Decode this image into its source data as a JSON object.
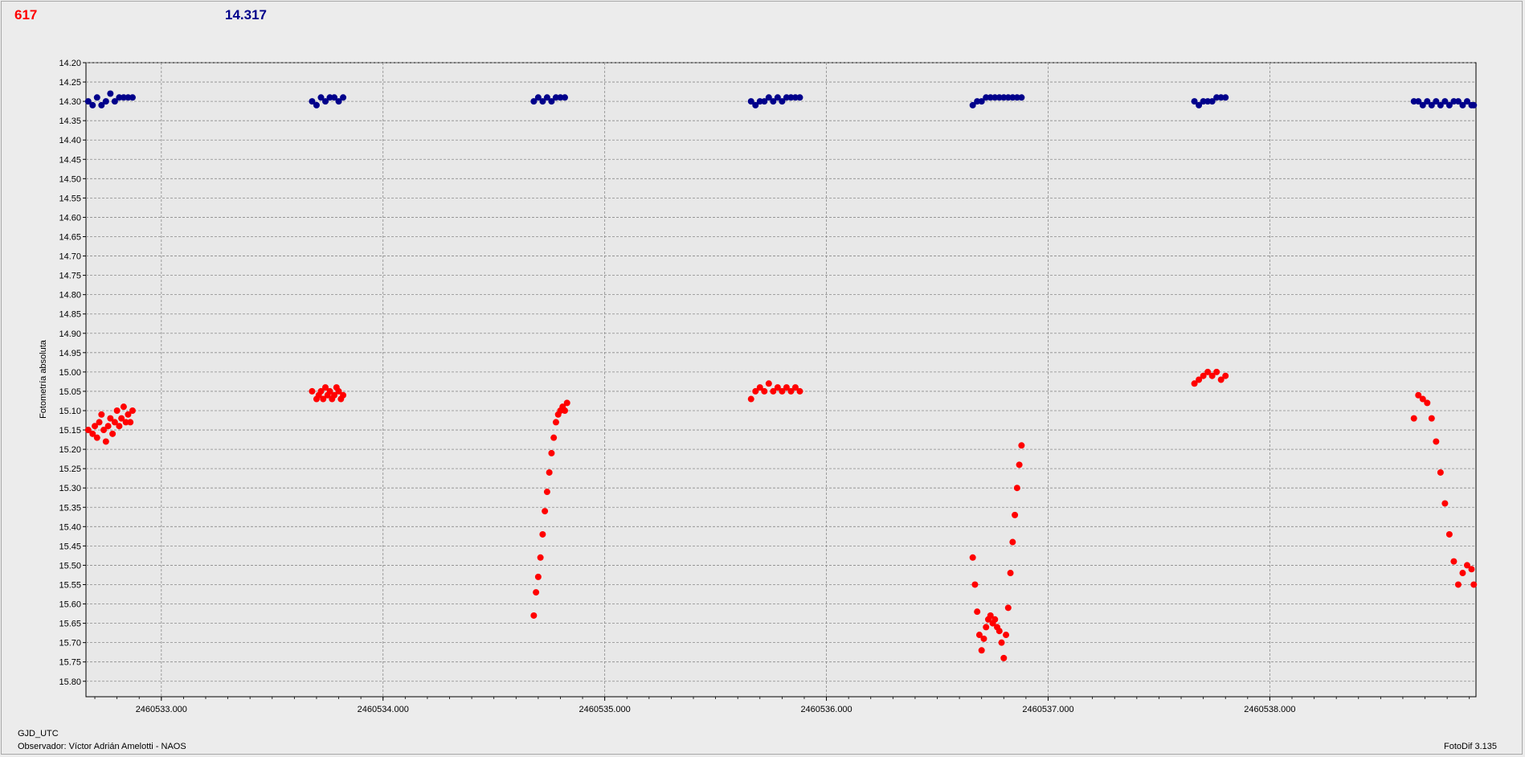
{
  "header": {
    "left_value": "617",
    "right_value": "14.317"
  },
  "footer": {
    "axis_name": "GJD_UTC",
    "observer": "Observador: Víctor Adrián Amelotti - NAOS",
    "software": "FotoDif 3.135"
  },
  "colors": {
    "series_red": "#ff0000",
    "series_blue": "#00008b",
    "grid": "#8a8a8a"
  },
  "chart_data": {
    "type": "scatter",
    "ylabel": "Fotometría absoluta",
    "xlabel": "",
    "y_inverted": true,
    "xlim": [
      2460532.66,
      2460538.93
    ],
    "ylim": [
      14.2,
      15.84
    ],
    "x_ticks": [
      "2460533.000",
      "2460534.000",
      "2460535.000",
      "2460536.000",
      "2460537.000",
      "2460538.000"
    ],
    "y_ticks": [
      "14.20",
      "14.25",
      "14.30",
      "14.35",
      "14.40",
      "14.45",
      "14.50",
      "14.55",
      "14.60",
      "14.65",
      "14.70",
      "14.75",
      "14.80",
      "14.85",
      "14.90",
      "14.95",
      "15.00",
      "15.05",
      "15.10",
      "15.15",
      "15.20",
      "15.25",
      "15.30",
      "15.35",
      "15.40",
      "15.45",
      "15.50",
      "15.55",
      "15.60",
      "15.65",
      "15.70",
      "15.75",
      "15.80"
    ],
    "grid": true,
    "series": [
      {
        "color": "#ff0000",
        "points": [
          [
            2460532.67,
            15.15
          ],
          [
            2460532.69,
            15.16
          ],
          [
            2460532.7,
            15.14
          ],
          [
            2460532.71,
            15.17
          ],
          [
            2460532.72,
            15.13
          ],
          [
            2460532.73,
            15.11
          ],
          [
            2460532.74,
            15.15
          ],
          [
            2460532.75,
            15.18
          ],
          [
            2460532.76,
            15.14
          ],
          [
            2460532.77,
            15.12
          ],
          [
            2460532.78,
            15.16
          ],
          [
            2460532.79,
            15.13
          ],
          [
            2460532.8,
            15.1
          ],
          [
            2460532.81,
            15.14
          ],
          [
            2460532.82,
            15.12
          ],
          [
            2460532.83,
            15.09
          ],
          [
            2460532.84,
            15.13
          ],
          [
            2460532.85,
            15.11
          ],
          [
            2460532.86,
            15.13
          ],
          [
            2460532.87,
            15.1
          ],
          [
            2460533.68,
            15.05
          ],
          [
            2460533.7,
            15.07
          ],
          [
            2460533.71,
            15.06
          ],
          [
            2460533.72,
            15.05
          ],
          [
            2460533.73,
            15.07
          ],
          [
            2460533.74,
            15.04
          ],
          [
            2460533.75,
            15.06
          ],
          [
            2460533.76,
            15.05
          ],
          [
            2460533.77,
            15.07
          ],
          [
            2460533.78,
            15.06
          ],
          [
            2460533.79,
            15.04
          ],
          [
            2460533.8,
            15.05
          ],
          [
            2460533.81,
            15.07
          ],
          [
            2460533.82,
            15.06
          ],
          [
            2460534.68,
            15.63
          ],
          [
            2460534.69,
            15.57
          ],
          [
            2460534.7,
            15.53
          ],
          [
            2460534.71,
            15.48
          ],
          [
            2460534.72,
            15.42
          ],
          [
            2460534.73,
            15.36
          ],
          [
            2460534.74,
            15.31
          ],
          [
            2460534.75,
            15.26
          ],
          [
            2460534.76,
            15.21
          ],
          [
            2460534.77,
            15.17
          ],
          [
            2460534.78,
            15.13
          ],
          [
            2460534.79,
            15.11
          ],
          [
            2460534.8,
            15.1
          ],
          [
            2460534.81,
            15.09
          ],
          [
            2460534.82,
            15.1
          ],
          [
            2460534.83,
            15.08
          ],
          [
            2460535.66,
            15.07
          ],
          [
            2460535.68,
            15.05
          ],
          [
            2460535.7,
            15.04
          ],
          [
            2460535.72,
            15.05
          ],
          [
            2460535.74,
            15.03
          ],
          [
            2460535.76,
            15.05
          ],
          [
            2460535.78,
            15.04
          ],
          [
            2460535.8,
            15.05
          ],
          [
            2460535.82,
            15.04
          ],
          [
            2460535.84,
            15.05
          ],
          [
            2460535.86,
            15.04
          ],
          [
            2460535.88,
            15.05
          ],
          [
            2460536.66,
            15.48
          ],
          [
            2460536.67,
            15.55
          ],
          [
            2460536.68,
            15.62
          ],
          [
            2460536.69,
            15.68
          ],
          [
            2460536.7,
            15.72
          ],
          [
            2460536.71,
            15.69
          ],
          [
            2460536.72,
            15.66
          ],
          [
            2460536.73,
            15.64
          ],
          [
            2460536.74,
            15.63
          ],
          [
            2460536.75,
            15.65
          ],
          [
            2460536.76,
            15.64
          ],
          [
            2460536.77,
            15.66
          ],
          [
            2460536.78,
            15.67
          ],
          [
            2460536.79,
            15.7
          ],
          [
            2460536.8,
            15.74
          ],
          [
            2460536.81,
            15.68
          ],
          [
            2460536.82,
            15.61
          ],
          [
            2460536.83,
            15.52
          ],
          [
            2460536.84,
            15.44
          ],
          [
            2460536.85,
            15.37
          ],
          [
            2460536.86,
            15.3
          ],
          [
            2460536.87,
            15.24
          ],
          [
            2460536.88,
            15.19
          ],
          [
            2460537.66,
            15.03
          ],
          [
            2460537.68,
            15.02
          ],
          [
            2460537.7,
            15.01
          ],
          [
            2460537.72,
            15.0
          ],
          [
            2460537.74,
            15.01
          ],
          [
            2460537.76,
            15.0
          ],
          [
            2460537.78,
            15.02
          ],
          [
            2460537.8,
            15.01
          ],
          [
            2460538.65,
            15.12
          ],
          [
            2460538.67,
            15.06
          ],
          [
            2460538.69,
            15.07
          ],
          [
            2460538.71,
            15.08
          ],
          [
            2460538.73,
            15.12
          ],
          [
            2460538.75,
            15.18
          ],
          [
            2460538.77,
            15.26
          ],
          [
            2460538.79,
            15.34
          ],
          [
            2460538.81,
            15.42
          ],
          [
            2460538.83,
            15.49
          ],
          [
            2460538.85,
            15.55
          ],
          [
            2460538.87,
            15.52
          ],
          [
            2460538.89,
            15.5
          ],
          [
            2460538.91,
            15.51
          ],
          [
            2460538.92,
            15.55
          ]
        ]
      },
      {
        "color": "#00008b",
        "points": [
          [
            2460532.67,
            14.3
          ],
          [
            2460532.69,
            14.31
          ],
          [
            2460532.71,
            14.29
          ],
          [
            2460532.73,
            14.31
          ],
          [
            2460532.75,
            14.3
          ],
          [
            2460532.77,
            14.28
          ],
          [
            2460532.79,
            14.3
          ],
          [
            2460532.81,
            14.29
          ],
          [
            2460532.83,
            14.29
          ],
          [
            2460532.85,
            14.29
          ],
          [
            2460532.87,
            14.29
          ],
          [
            2460533.68,
            14.3
          ],
          [
            2460533.7,
            14.31
          ],
          [
            2460533.72,
            14.29
          ],
          [
            2460533.74,
            14.3
          ],
          [
            2460533.76,
            14.29
          ],
          [
            2460533.78,
            14.29
          ],
          [
            2460533.8,
            14.3
          ],
          [
            2460533.82,
            14.29
          ],
          [
            2460534.68,
            14.3
          ],
          [
            2460534.7,
            14.29
          ],
          [
            2460534.72,
            14.3
          ],
          [
            2460534.74,
            14.29
          ],
          [
            2460534.76,
            14.3
          ],
          [
            2460534.78,
            14.29
          ],
          [
            2460534.8,
            14.29
          ],
          [
            2460534.82,
            14.29
          ],
          [
            2460535.66,
            14.3
          ],
          [
            2460535.68,
            14.31
          ],
          [
            2460535.7,
            14.3
          ],
          [
            2460535.72,
            14.3
          ],
          [
            2460535.74,
            14.29
          ],
          [
            2460535.76,
            14.3
          ],
          [
            2460535.78,
            14.29
          ],
          [
            2460535.8,
            14.3
          ],
          [
            2460535.82,
            14.29
          ],
          [
            2460535.84,
            14.29
          ],
          [
            2460535.86,
            14.29
          ],
          [
            2460535.88,
            14.29
          ],
          [
            2460536.66,
            14.31
          ],
          [
            2460536.68,
            14.3
          ],
          [
            2460536.7,
            14.3
          ],
          [
            2460536.72,
            14.29
          ],
          [
            2460536.74,
            14.29
          ],
          [
            2460536.76,
            14.29
          ],
          [
            2460536.78,
            14.29
          ],
          [
            2460536.8,
            14.29
          ],
          [
            2460536.82,
            14.29
          ],
          [
            2460536.84,
            14.29
          ],
          [
            2460536.86,
            14.29
          ],
          [
            2460536.88,
            14.29
          ],
          [
            2460537.66,
            14.3
          ],
          [
            2460537.68,
            14.31
          ],
          [
            2460537.7,
            14.3
          ],
          [
            2460537.72,
            14.3
          ],
          [
            2460537.74,
            14.3
          ],
          [
            2460537.76,
            14.29
          ],
          [
            2460537.78,
            14.29
          ],
          [
            2460537.8,
            14.29
          ],
          [
            2460538.65,
            14.3
          ],
          [
            2460538.67,
            14.3
          ],
          [
            2460538.69,
            14.31
          ],
          [
            2460538.71,
            14.3
          ],
          [
            2460538.73,
            14.31
          ],
          [
            2460538.75,
            14.3
          ],
          [
            2460538.77,
            14.31
          ],
          [
            2460538.79,
            14.3
          ],
          [
            2460538.81,
            14.31
          ],
          [
            2460538.83,
            14.3
          ],
          [
            2460538.85,
            14.3
          ],
          [
            2460538.87,
            14.31
          ],
          [
            2460538.89,
            14.3
          ],
          [
            2460538.91,
            14.31
          ],
          [
            2460538.92,
            14.31
          ]
        ]
      }
    ]
  }
}
